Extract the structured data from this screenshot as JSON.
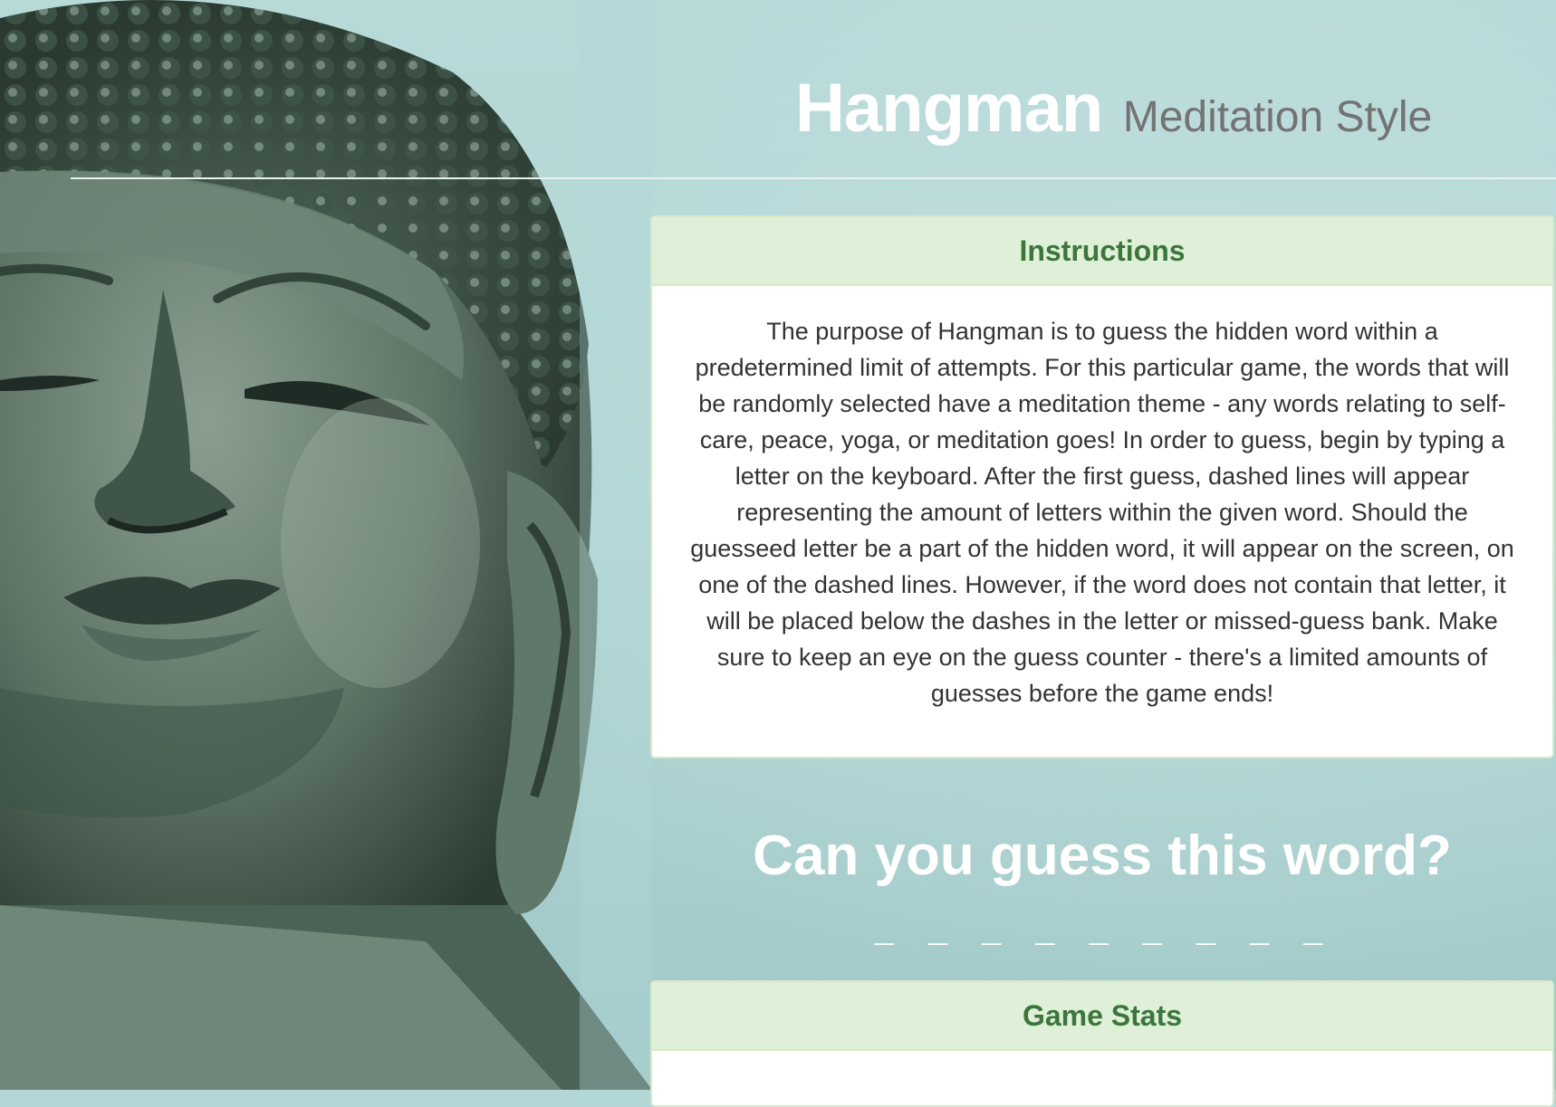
{
  "header": {
    "title": "Hangman",
    "subtitle": "Meditation Style"
  },
  "instructions": {
    "heading": "Instructions",
    "text": "The purpose of Hangman is to guess the hidden word within a predetermined limit of attempts. For this particular game, the words that will be randomly selected have a meditation theme - any words relating to self-care, peace, yoga, or meditation goes! In order to guess, begin by typing a letter on the keyboard. After the first guess, dashed lines will appear representing the amount of letters within the given word. Should the guesseed letter be a part of the hidden word, it will appear on the screen, on one of the dashed lines. However, if the word does not contain that letter, it will be placed below the dashes in the letter or missed-guess bank. Make sure to keep an eye on the guess counter - there's a limited amounts of guesses before the game ends!"
  },
  "game": {
    "prompt": "Can you guess this word?",
    "word_display": "_ _ _ _ _ _ _ _ _"
  },
  "stats": {
    "heading": "Game Stats"
  },
  "colors": {
    "background": "#b3d7d6",
    "panel_heading_bg": "#dff0d8",
    "panel_heading_text": "#3c763d",
    "title_text": "#ffffff",
    "subtitle_text": "#737373"
  }
}
